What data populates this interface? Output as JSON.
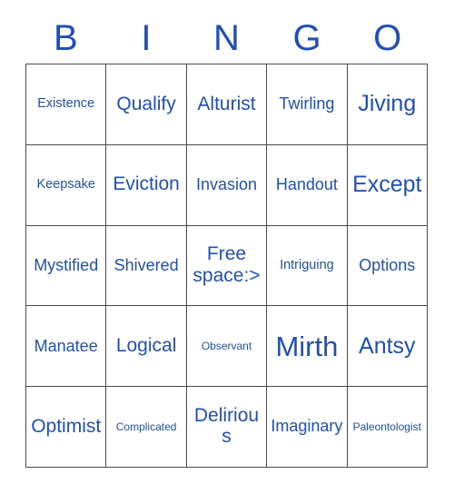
{
  "card": {
    "title": "BINGO",
    "text_color": "#2050b5",
    "border_color": "#4a4a4a",
    "background_color": "#ffffff",
    "header_letters": [
      "B",
      "I",
      "N",
      "G",
      "O"
    ],
    "columns": 5,
    "rows": 5,
    "free_space_text": "Free space:>",
    "cells": [
      [
        {
          "label": "Existence",
          "size": "sz-s"
        },
        {
          "label": "Qualify",
          "size": "sz-l"
        },
        {
          "label": "Alturist",
          "size": "sz-l"
        },
        {
          "label": "Twirling",
          "size": "sz-m"
        },
        {
          "label": "Jiving",
          "size": "sz-xl"
        }
      ],
      [
        {
          "label": "Keepsake",
          "size": "sz-s"
        },
        {
          "label": "Eviction",
          "size": "sz-l"
        },
        {
          "label": "Invasion",
          "size": "sz-m"
        },
        {
          "label": "Handout",
          "size": "sz-m"
        },
        {
          "label": "Except",
          "size": "sz-xl"
        }
      ],
      [
        {
          "label": "Mystified",
          "size": "sz-m"
        },
        {
          "label": "Shivered",
          "size": "sz-m"
        },
        {
          "label": "Free space:>",
          "size": "sz-free"
        },
        {
          "label": "Intriguing",
          "size": "sz-s"
        },
        {
          "label": "Options",
          "size": "sz-m"
        }
      ],
      [
        {
          "label": "Manatee",
          "size": "sz-m"
        },
        {
          "label": "Logical",
          "size": "sz-l"
        },
        {
          "label": "Observant",
          "size": "sz-xs"
        },
        {
          "label": "Mirth",
          "size": "sz-xxl"
        },
        {
          "label": "Antsy",
          "size": "sz-xl"
        }
      ],
      [
        {
          "label": "Optimist",
          "size": "sz-l"
        },
        {
          "label": "Complicated",
          "size": "sz-xs"
        },
        {
          "label": "Delirious",
          "size": "sz-l"
        },
        {
          "label": "Imaginary",
          "size": "sz-m"
        },
        {
          "label": "Paleontologist",
          "size": "sz-xs"
        }
      ]
    ]
  }
}
